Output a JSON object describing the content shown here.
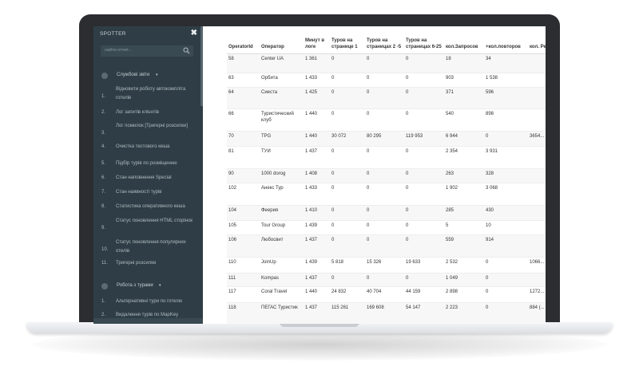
{
  "sidebar": {
    "title": "SPOTTER",
    "close_glyph": "✖",
    "search_placeholder": "найти отчет...",
    "sections": [
      {
        "label": "Службові звіти",
        "chevron": "▾"
      },
      {
        "label": "Робота з турами",
        "chevron": "▾"
      }
    ],
    "service_items": [
      {
        "num": "1.",
        "label": "Відновити роботу автокомпліта готелів"
      },
      {
        "num": "2.",
        "label": "Лог запитів клієнтів"
      },
      {
        "num": "3.",
        "label": "Лог помилок [Тригерні розсилки]"
      },
      {
        "num": "4.",
        "label": "Очистка тестового кеша"
      },
      {
        "num": "5.",
        "label": "Підбір турів по розміщенню"
      },
      {
        "num": "6.",
        "label": "Стан наповнення Special"
      },
      {
        "num": "7.",
        "label": "Стан наявності турів"
      },
      {
        "num": "8.",
        "label": "Статистика оперативного кеша"
      },
      {
        "num": "9.",
        "label": "Статус поновлення HTML сторінок"
      },
      {
        "num": "10.",
        "label": "Статус поновлення популярних отелів"
      },
      {
        "num": "11.",
        "label": "Тригерні розсилки"
      }
    ],
    "tour_items": [
      {
        "num": "1.",
        "label": "Альтернативні тури по готелю"
      },
      {
        "num": "2.",
        "label": "Видалення турів по MapKey"
      }
    ]
  },
  "table": {
    "headers": [
      "OperatorId",
      "Оператор",
      "Минут в логе",
      "Туров на странице 1",
      "Туров на страницах 2 -5",
      "Туров на страницах 6-25",
      "кол.Запросов",
      "+кол.повторов",
      "кол. Резу..."
    ],
    "rows": [
      [
        "58",
        "Center UA",
        "1 361",
        "0",
        "0",
        "0",
        "18",
        "34",
        ""
      ],
      [
        "63",
        "Орбита",
        "1 433",
        "0",
        "0",
        "0",
        "903",
        "1 538",
        ""
      ],
      [
        "64",
        "Сиеста",
        "1 425",
        "0",
        "0",
        "0",
        "371",
        "596",
        ""
      ],
      [
        "66",
        "Туристический клуб",
        "1 440",
        "0",
        "0",
        "0",
        "540",
        "898",
        ""
      ],
      [
        "70",
        "TPG",
        "1 440",
        "30 072",
        "80 295",
        "119 953",
        "6 944",
        "0",
        "3654..."
      ],
      [
        "81",
        "ТУИ",
        "1 437",
        "0",
        "0",
        "0",
        "2 354",
        "3 931",
        ""
      ],
      [
        "90",
        "1000 dorog",
        "1 408",
        "0",
        "0",
        "0",
        "263",
        "328",
        ""
      ],
      [
        "102",
        "Анекс Тур",
        "1 433",
        "0",
        "0",
        "0",
        "1 902",
        "3 068",
        ""
      ],
      [
        "104",
        "Феерия",
        "1 410",
        "0",
        "0",
        "0",
        "285",
        "430",
        ""
      ],
      [
        "105",
        "Tour Group",
        "1 439",
        "0",
        "0",
        "0",
        "5",
        "10",
        ""
      ],
      [
        "106",
        "Любосвит",
        "1 437",
        "0",
        "0",
        "0",
        "559",
        "914",
        ""
      ],
      [
        "110",
        "JoinUp",
        "1 439",
        "5 818",
        "15 326",
        "19 633",
        "2 532",
        "0",
        "1066..."
      ],
      [
        "111",
        "Kompas",
        "1 437",
        "0",
        "0",
        "0",
        "1 049",
        "0",
        ""
      ],
      [
        "117",
        "Coral Travel",
        "1 440",
        "24 832",
        "40 704",
        "44 159",
        "2 898",
        "0",
        "1272..."
      ],
      [
        "118",
        "ПЕГАС Туристик",
        "1 437",
        "115 261",
        "169 608",
        "54 147",
        "2 223",
        "0",
        "884 (..."
      ]
    ]
  }
}
